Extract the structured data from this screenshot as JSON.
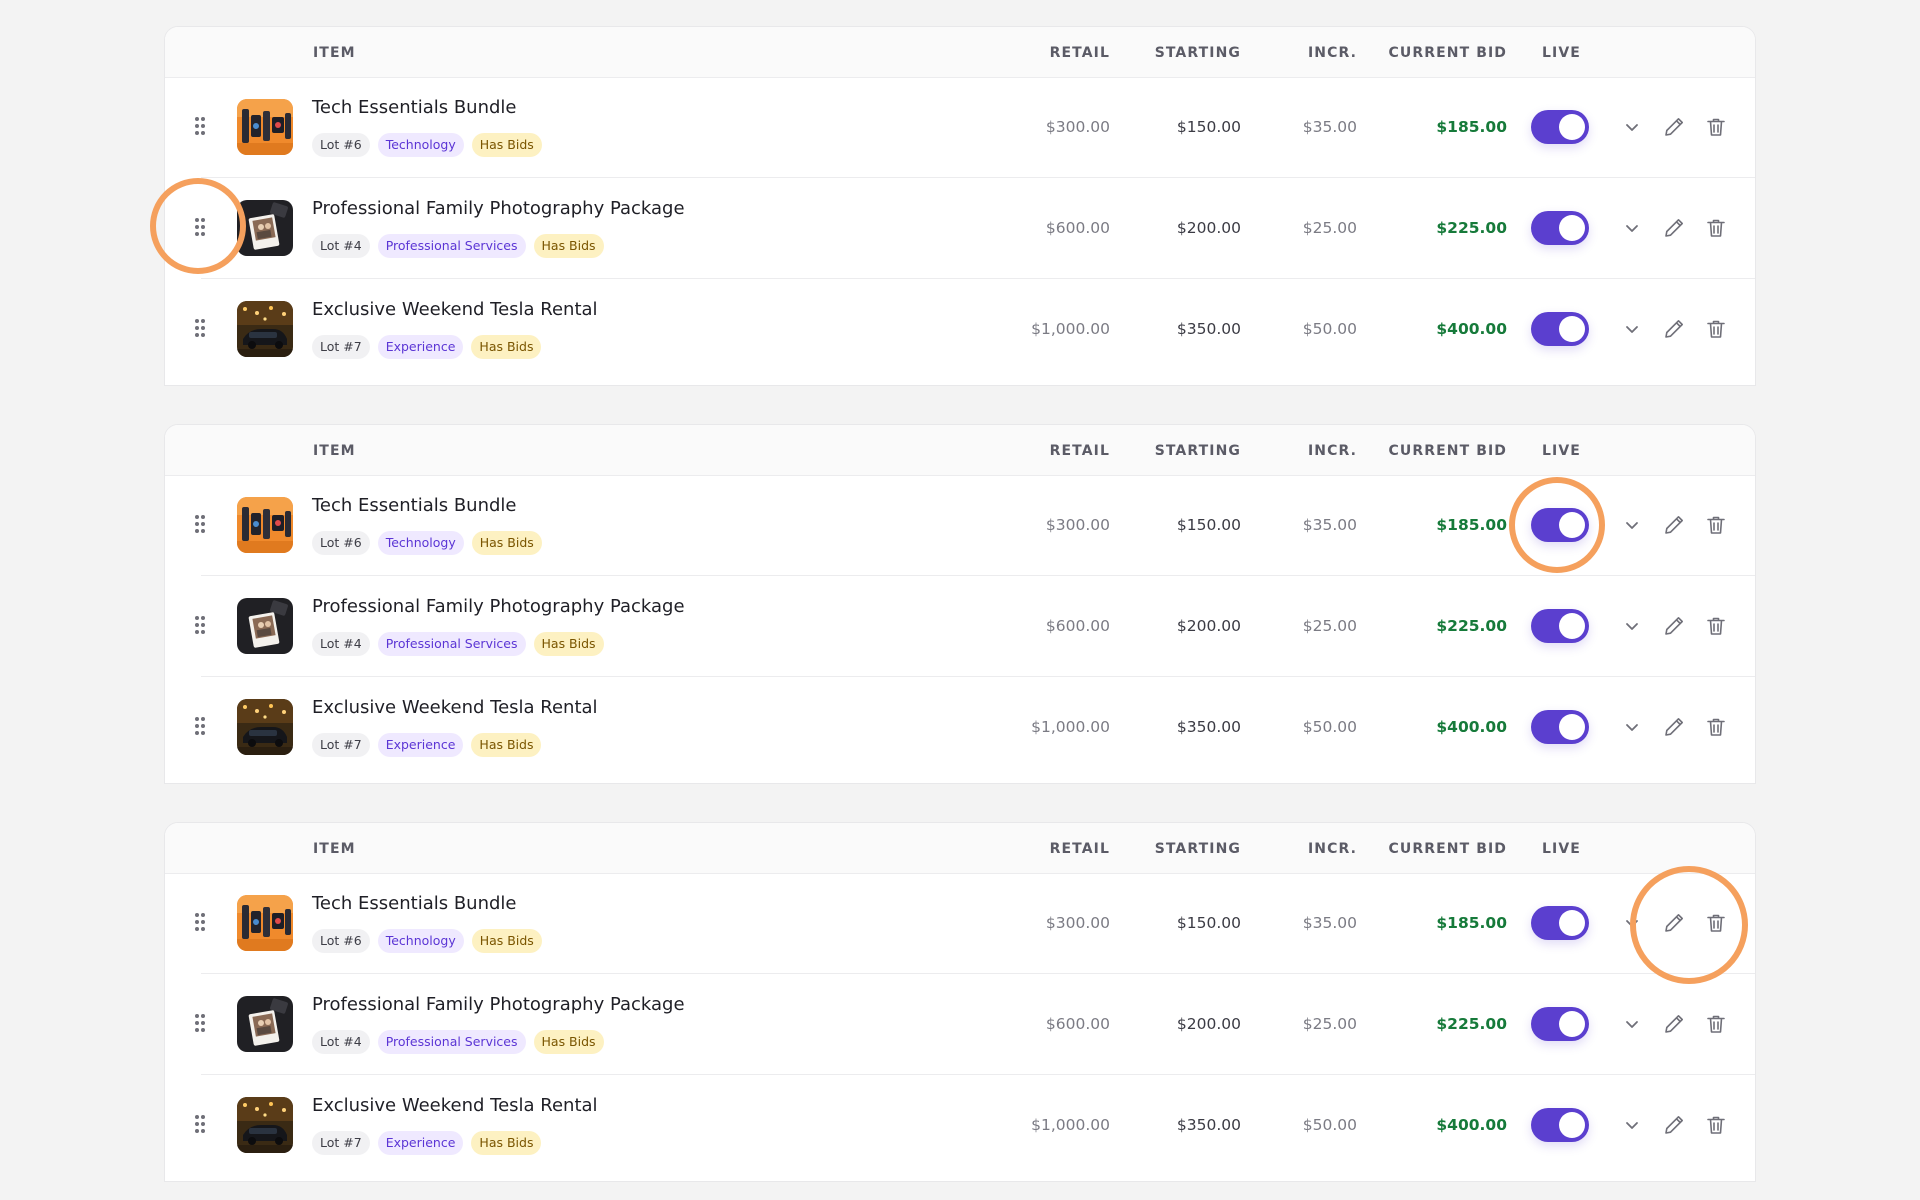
{
  "columns": {
    "item": "ITEM",
    "retail": "RETAIL",
    "starting": "STARTING",
    "incr": "INCR.",
    "current_bid": "CURRENT BID",
    "live": "LIVE"
  },
  "items": [
    {
      "title": "Tech Essentials Bundle",
      "lot": "Lot #6",
      "category": "Technology",
      "status": "Has Bids",
      "retail": "$300.00",
      "starting": "$150.00",
      "incr": "$35.00",
      "current_bid": "$185.00",
      "live": true,
      "thumb_icon": "tech-bundle-thumbnail"
    },
    {
      "title": "Professional Family Photography Package",
      "lot": "Lot #4",
      "category": "Professional Services",
      "status": "Has Bids",
      "retail": "$600.00",
      "starting": "$200.00",
      "incr": "$25.00",
      "current_bid": "$225.00",
      "live": true,
      "thumb_icon": "photo-package-thumbnail"
    },
    {
      "title": "Exclusive Weekend Tesla Rental",
      "lot": "Lot #7",
      "category": "Experience",
      "status": "Has Bids",
      "retail": "$1,000.00",
      "starting": "$350.00",
      "incr": "$50.00",
      "current_bid": "$400.00",
      "live": true,
      "thumb_icon": "tesla-rental-thumbnail"
    }
  ],
  "colors": {
    "accent": "#5b3fcf",
    "current_bid": "#167a3a",
    "highlight_ring": "#f5a05d",
    "category_tag_bg": "#efe9ff",
    "status_tag_bg": "#fdf1c2"
  }
}
